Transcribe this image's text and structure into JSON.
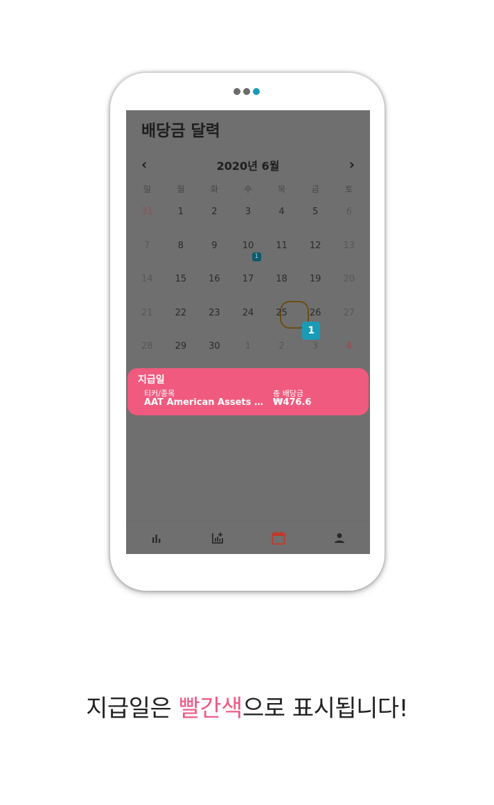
{
  "pager": {
    "count": 3,
    "active": 2
  },
  "screen": {
    "title": "배당금 달력",
    "month_label": "2020년 6월",
    "prev_icon": "chevron-left-icon",
    "next_icon": "chevron-right-icon",
    "weekdays": [
      "일",
      "월",
      "화",
      "수",
      "목",
      "금",
      "토"
    ],
    "days": [
      [
        "31",
        "1",
        "2",
        "3",
        "4",
        "5",
        "6"
      ],
      [
        "7",
        "8",
        "9",
        "10",
        "11",
        "12",
        "13"
      ],
      [
        "14",
        "15",
        "16",
        "17",
        "18",
        "19",
        "20"
      ],
      [
        "21",
        "22",
        "23",
        "24",
        "25",
        "26",
        "27"
      ],
      [
        "28",
        "29",
        "30",
        "1",
        "2",
        "3",
        "4"
      ]
    ],
    "day10_badge": "1",
    "today_badge": "1",
    "pay_card": {
      "title": "지급일",
      "ticker_label": "티커/종목",
      "ticker_value": "AAT American Assets …",
      "total_label": "총 배당금",
      "total_value": "₩476.6"
    },
    "tabs": [
      {
        "icon": "bar-chart-icon"
      },
      {
        "icon": "add-chart-icon"
      },
      {
        "icon": "calendar-icon",
        "active": true
      },
      {
        "icon": "person-icon"
      }
    ],
    "colors": {
      "active_tab": "#c0392b",
      "card": "#f05a7e",
      "badge": "#1a9bb5"
    }
  },
  "caption": {
    "part1": "지급일은 ",
    "highlight": "빨간색",
    "part2": "으로 표시됩니다!"
  }
}
